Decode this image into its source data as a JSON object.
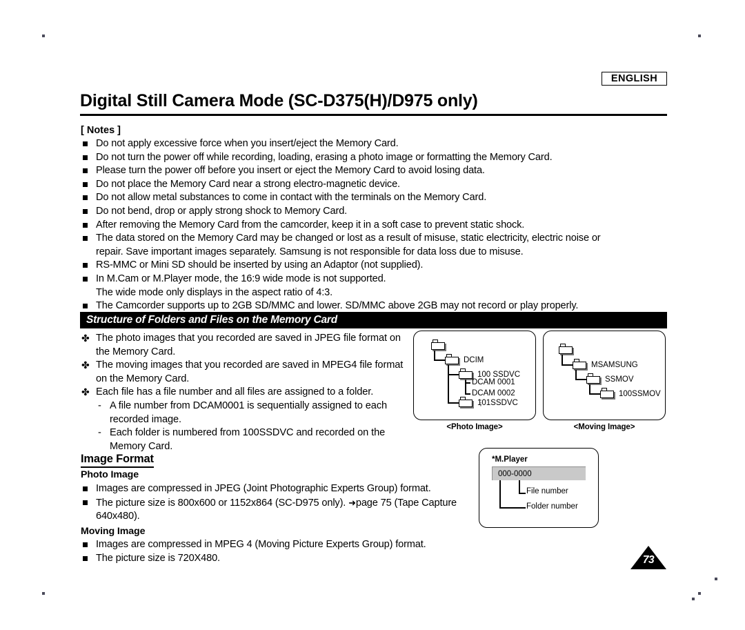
{
  "header": {
    "language_badge": "ENGLISH",
    "title": "Digital Still Camera Mode (SC-D375(H)/D975 only)"
  },
  "notes": {
    "label": "[ Notes ]",
    "items": [
      {
        "text": "Do not apply excessive force when you insert/eject the Memory Card."
      },
      {
        "text": "Do not turn the power off while recording, loading, erasing a photo image or formatting the Memory Card."
      },
      {
        "text": "Please turn the power off before you insert or eject the Memory Card to avoid losing data."
      },
      {
        "text": "Do not place the Memory Card near a strong electro-magnetic device."
      },
      {
        "text": "Do not allow metal substances to come in contact with the terminals on the Memory Card."
      },
      {
        "text": "Do not bend, drop or apply strong shock to Memory Card."
      },
      {
        "text": "After removing the Memory Card from the camcorder, keep it in a soft case to prevent static shock."
      },
      {
        "text": "The data stored on the Memory Card may be changed or lost as a result of misuse, static electricity, electric noise or",
        "cont": "repair. Save important images separately. Samsung is not responsible for data loss due to misuse."
      },
      {
        "text": "RS-MMC or Mini SD should be inserted by using an Adaptor (not supplied)."
      },
      {
        "text": "In M.Cam or M.Player mode, the 16:9 wide mode is not supported.",
        "cont": "The wide mode only displays in the aspect ratio of 4:3."
      },
      {
        "text": "The Camcorder supports up to 2GB SD/MMC and lower. SD/MMC above 2GB may not record or play properly."
      }
    ]
  },
  "structure_section": {
    "band_title": "Structure of Folders and Files on the Memory Card",
    "bullets": [
      {
        "text": "The photo images that you recorded are saved in JPEG file",
        "cont": "format on the Memory Card."
      },
      {
        "text": "The moving images that you recorded are saved in MPEG4 file",
        "cont": "format on the Memory Card."
      },
      {
        "text": "Each file has a file number and all files are assigned to a folder."
      }
    ],
    "sub_bullets": [
      {
        "dash": "-",
        "text": "A file number from DCAM0001 is sequentially assigned to each",
        "cont": "recorded image."
      },
      {
        "dash": "-",
        "text": "Each folder is numbered from 100SSDVC and recorded on the",
        "cont": "Memory Card."
      }
    ]
  },
  "photo_diagram": {
    "caption": "<Photo Image>",
    "nodes": {
      "root": "",
      "dcim": "DCIM",
      "folder100": "100 SSDVC",
      "file1": "DCAM 0001",
      "file2": "DCAM 0002",
      "ellipsis": "⋮",
      "folder101": "101SSDVC"
    }
  },
  "moving_diagram": {
    "caption": "<Moving Image>",
    "nodes": {
      "root": "",
      "msamsung": "MSAMSUNG",
      "ssmov": "SSMOV",
      "folder100": "100SSMOV"
    }
  },
  "mplayer_diagram": {
    "title": "*M.Player",
    "field_value": "000-0000",
    "file_number_label": "File number",
    "folder_number_label": "Folder number"
  },
  "image_format": {
    "section_title": "Image Format",
    "photo": {
      "heading": "Photo Image",
      "items": [
        {
          "text": "Images are compressed in JPEG (Joint Photographic Experts Group) format."
        },
        {
          "text": "The picture size is 800x600 or 1152x864 (SC-D975 only).",
          "arrow": "➜",
          "after_arrow": "page 75",
          "cont": "(Tape Capture 640x480)."
        }
      ]
    },
    "moving": {
      "heading": "Moving Image",
      "items": [
        {
          "text": "Images are compressed in MPEG 4 (Moving Picture Experts Group) format."
        },
        {
          "text": "The picture size is 720X480."
        }
      ]
    }
  },
  "page_number": "73",
  "colors": {
    "ink": "#000000",
    "paper": "#ffffff",
    "field_gray": "#c9c9c9",
    "shadow_gray": "#777777"
  }
}
